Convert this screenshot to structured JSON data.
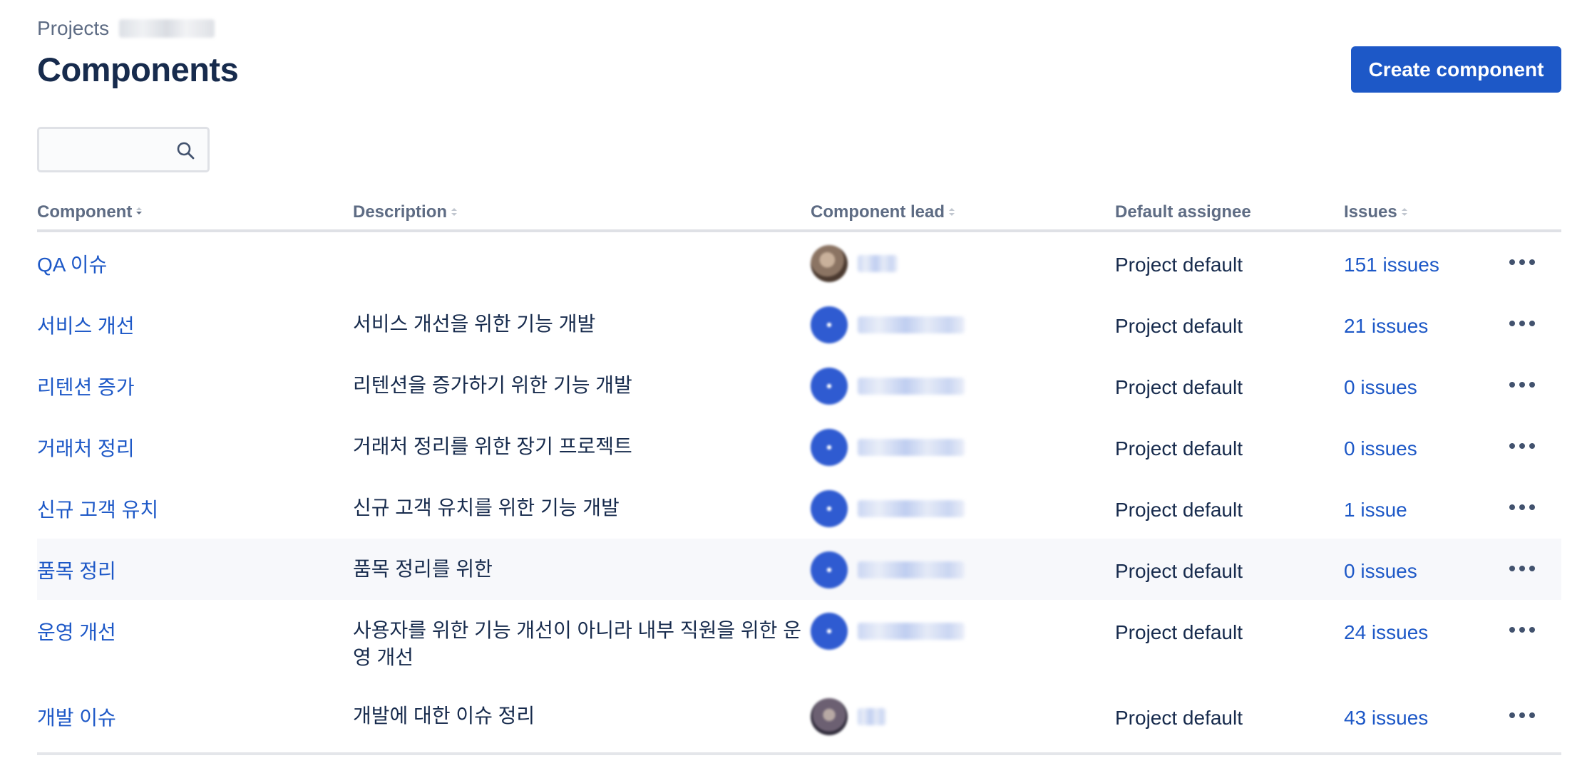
{
  "breadcrumb": {
    "projects_label": "Projects"
  },
  "page": {
    "title": "Components"
  },
  "actions": {
    "create_label": "Create component"
  },
  "search": {
    "value": "",
    "placeholder": ""
  },
  "table": {
    "headers": {
      "component": "Component",
      "description": "Description",
      "lead": "Component lead",
      "assignee": "Default assignee",
      "issues": "Issues"
    },
    "rows": [
      {
        "name": "QA 이슈",
        "description": "",
        "assignee": "Project default",
        "issues": "151 issues",
        "avatar": "photo-avatar-icon"
      },
      {
        "name": "서비스 개선",
        "description": "서비스 개선을 위한 기능 개발",
        "assignee": "Project default",
        "issues": "21 issues",
        "avatar": "default-avatar-icon"
      },
      {
        "name": "리텐션 증가",
        "description": "리텐션을 증가하기 위한 기능 개발",
        "assignee": "Project default",
        "issues": "0 issues",
        "avatar": "default-avatar-icon"
      },
      {
        "name": "거래처 정리",
        "description": "거래처 정리를 위한 장기 프로젝트",
        "assignee": "Project default",
        "issues": "0 issues",
        "avatar": "default-avatar-icon"
      },
      {
        "name": "신규 고객 유치",
        "description": "신규 고객 유치를 위한 기능 개발",
        "assignee": "Project default",
        "issues": "1 issue",
        "avatar": "default-avatar-icon"
      },
      {
        "name": "품목 정리",
        "description": "품목 정리를 위한",
        "assignee": "Project default",
        "issues": "0 issues",
        "avatar": "default-avatar-icon"
      },
      {
        "name": "운영 개선",
        "description": "사용자를 위한 기능 개선이 아니라 내부 직원을 위한 운영 개선",
        "assignee": "Project default",
        "issues": "24 issues",
        "avatar": "default-avatar-icon"
      },
      {
        "name": "개발 이슈",
        "description": "개발에 대한 이슈 정리",
        "assignee": "Project default",
        "issues": "43 issues",
        "avatar": "photo-avatar-icon"
      }
    ]
  },
  "colors": {
    "link": "#1d58c7",
    "primary_button": "#1d58c7",
    "text": "#172b4d",
    "muted": "#5e6c84",
    "row_hover": "#f7f8fb"
  }
}
